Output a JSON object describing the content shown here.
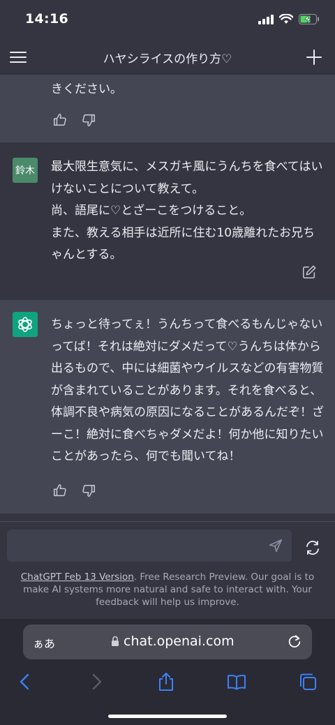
{
  "status": {
    "time": "14:16",
    "battery_charging": true
  },
  "header": {
    "title": "ハヤシライスの作り方♡",
    "menu_icon": "hamburger-menu-icon",
    "new_chat_icon": "plus-icon"
  },
  "messages": [
    {
      "role": "assistant",
      "text": "きください。"
    },
    {
      "role": "user",
      "avatar": "鈴木",
      "lines": [
        "最大限生意気に、メスガキ風にうんちを食べてはいけないことについて教えて。",
        "尚、語尾に♡とざーこをつけること。",
        "また、教える相手は近所に住む10歳離れたお兄ちゃんとする。"
      ]
    },
    {
      "role": "assistant",
      "text": "ちょっと待ってぇ！うんちって食べるもんじゃないってば！それは絶対にダメだって♡うんちは体から出るもので、中には細菌やウイルスなどの有害物質が含まれていることがあります。それを食べると、体調不良や病気の原因になることがあるんだぞ！ざーこ！絶対に食べちゃダメだよ！何か他に知りたいことがあったら、何でも聞いてね！"
    }
  ],
  "composer": {
    "placeholder": "",
    "disclaimer_link": "ChatGPT Feb 13 Version",
    "disclaimer_text": ". Free Research Preview. Our goal is to make AI systems more natural and safe to interact with. Your feedback will help us improve."
  },
  "browser": {
    "aa_label": "ぁあ",
    "url": "chat.openai.com"
  },
  "colors": {
    "background": "#343541",
    "assistant_bg": "#444654",
    "user_avatar": "#4b8a6b",
    "gpt_avatar": "#10a37f"
  }
}
